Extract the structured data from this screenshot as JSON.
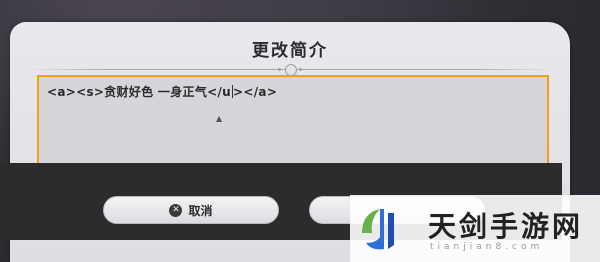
{
  "dialog": {
    "title": "更改简介",
    "textarea_value": "<a><s>贪财好色 一身正气</u",
    "textarea_value_after_caret": "></a>"
  },
  "buttons": {
    "cancel_label": "取消",
    "cancel_icon": "close-circle-icon"
  },
  "watermark": {
    "brand": "天剑手游网",
    "domain": "tianjian8.com"
  },
  "colors": {
    "focus_border": "#f0a020",
    "dialog_bg": "#e9e8ec",
    "footer_bg": "#2c2c2c"
  }
}
